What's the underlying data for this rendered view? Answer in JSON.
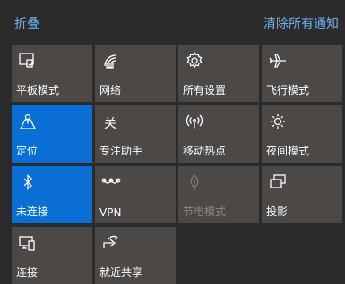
{
  "header": {
    "collapse_label": "折叠",
    "clear_all_label": "清除所有通知"
  },
  "tiles": [
    {
      "label": "平板模式",
      "icon": "tablet-mode-icon",
      "active": false
    },
    {
      "label": "网络",
      "icon": "network-icon",
      "active": false
    },
    {
      "label": "所有设置",
      "icon": "gear-icon",
      "active": false
    },
    {
      "label": "飞行模式",
      "icon": "airplane-icon",
      "active": false
    },
    {
      "label": "定位",
      "icon": "location-icon",
      "active": true
    },
    {
      "label": "专注助手",
      "icon": "focus-assist-icon",
      "icon_text": "关",
      "active": false
    },
    {
      "label": "移动热点",
      "icon": "mobile-hotspot-icon",
      "active": false
    },
    {
      "label": "夜间模式",
      "icon": "night-light-icon",
      "active": false
    },
    {
      "label": "未连接",
      "icon": "bluetooth-icon",
      "active": true
    },
    {
      "label": "VPN",
      "icon": "vpn-icon",
      "active": false
    },
    {
      "label": "节电模式",
      "icon": "battery-saver-icon",
      "active": false,
      "disabled": true
    },
    {
      "label": "投影",
      "icon": "project-icon",
      "active": false
    },
    {
      "label": "连接",
      "icon": "connect-icon",
      "active": false
    },
    {
      "label": "就近共享",
      "icon": "nearby-share-icon",
      "active": false
    }
  ],
  "colors": {
    "background": "#2b2b2b",
    "tile": "#4b4846",
    "active_tile": "#0a6fd4",
    "link": "#6fb2f0"
  }
}
